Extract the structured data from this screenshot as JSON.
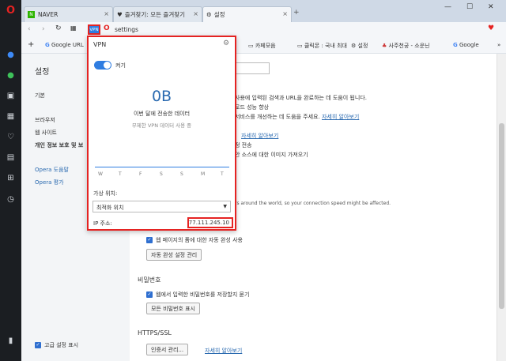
{
  "tabs": [
    {
      "label": "NAVER",
      "icon": "naver-icon"
    },
    {
      "label": "즐겨찾기: 모든 즐겨찾기",
      "icon": "heart-icon"
    },
    {
      "label": "설정",
      "icon": "gear-icon"
    }
  ],
  "address": {
    "vpn_badge": "VPN",
    "url": "settings"
  },
  "bookmarks": [
    "Google URL",
    "카페모음",
    "클릭몬 : 국내 최대",
    "설정",
    "사주천궁 - 소운닌",
    "Google"
  ],
  "settings_nav": {
    "title": "설정",
    "items": [
      "기본",
      "브라우저",
      "웹 사이트",
      "개인 정보 보호 및 보"
    ],
    "links": [
      "Opera 도움말",
      "Opera 평가"
    ],
    "advanced_label": "고급 설정 표시"
  },
  "content": {
    "lines": [
      "사용에 입력된 검색과 URL을 완료하는 데 도움이 됩니다.",
      "로드 성능 향상",
      "서비스를 개선하는 데 도움을 주세요.",
      "자세히 알아보기",
      "자세히 알아보기",
      "정 전송",
      "안 소스에 대한 이미지 가져오기",
      "rs around the world, so your connection speed might be affected."
    ],
    "autofill_check": "웹 페이지의 폼에 대한 자동 완성 사용",
    "autofill_button": "자동 완성 설정 관리",
    "password_title": "비밀번호",
    "password_check": "웹에서 입력한 비밀번호를 저장할지 묻기",
    "password_button": "모든 비밀번호 표시",
    "https_title": "HTTPS/SSL",
    "cert_button": "인증서 관리...",
    "cert_link": "자세히 알아보기"
  },
  "vpn": {
    "title": "VPN",
    "toggle_label": "켜기",
    "data_amount": "0B",
    "data_caption": "이번 달에 전송한 데이터",
    "data_sub": "무제한 VPN 데이터 사용 중",
    "days": [
      "W",
      "T",
      "F",
      "S",
      "S",
      "M",
      "T"
    ],
    "location_label": "가상 위치:",
    "location_value": "최적화 위치",
    "ip_label": "IP 주소:",
    "ip_value": "77.111.245.10"
  }
}
